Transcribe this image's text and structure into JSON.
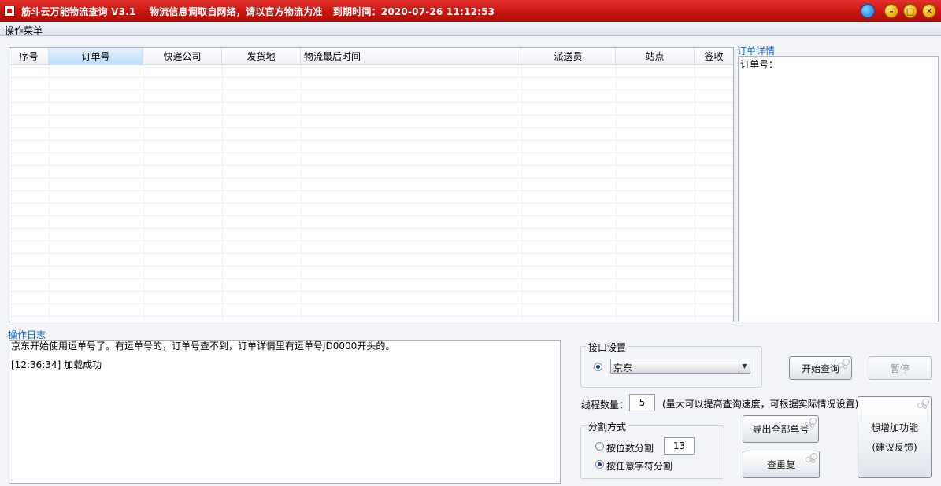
{
  "titlebar": {
    "title": "筋斗云万能物流查询 V3.1    物流信息调取自网络，请以官方物流为准   到期时间：2020-07-26 11:12:53"
  },
  "menu": {
    "operations": "操作菜单"
  },
  "table": {
    "columns": [
      "序号",
      "订单号",
      "快递公司",
      "发货地",
      "物流最后时间",
      "派送员",
      "站点",
      "签收"
    ],
    "rows": []
  },
  "detail": {
    "label": "订单详情",
    "content": "订单号："
  },
  "log": {
    "label": "操作日志",
    "lines": [
      "京东开始使用运单号了。有运单号的，订单号查不到，订单详情里有运单号JD0000开头的。",
      "[12:36:34] 加载成功"
    ]
  },
  "api": {
    "group_title": "接口设置",
    "selected": "京东"
  },
  "threads": {
    "label": "线程数量：",
    "value": "5",
    "hint": "(量大可以提高查询速度，可根据实际情况设置)"
  },
  "split": {
    "group_title": "分割方式",
    "by_digits_label": "按位数分割",
    "digits_value": "13",
    "by_char_label": "按任意字符分割",
    "selected": "by_char"
  },
  "buttons": {
    "start": "开始查询",
    "pause": "暂停",
    "export": "导出全部单号",
    "dedupe": "查重复",
    "feature_line1": "想增加功能",
    "feature_line2": "(建议反馈)"
  }
}
